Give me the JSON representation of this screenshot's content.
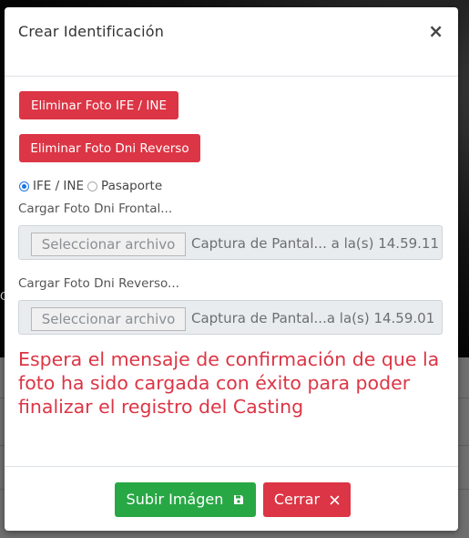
{
  "background": {
    "edge_char": "C"
  },
  "modal": {
    "title": "Crear Identificación",
    "close_symbol": "×",
    "delete_front_label": "Eliminar Foto IFE / INE",
    "delete_back_label": "Eliminar Foto Dni Reverso",
    "id_type": {
      "options": [
        {
          "label": "IFE / INE",
          "selected": true
        },
        {
          "label": "Pasaporte",
          "selected": false
        }
      ]
    },
    "front_upload": {
      "label": "Cargar Foto Dni Frontal...",
      "button_label": "Seleccionar archivo",
      "file_name": "Captura de Pantal... a la(s) 14.59.11"
    },
    "back_upload": {
      "label": "Cargar Foto Dni Reverso...",
      "button_label": "Seleccionar archivo",
      "file_name": "Captura de Pantal...a la(s) 14.59.01"
    },
    "warning_text": "Espera el mensaje de confirmación de que la foto ha sido cargada con éxito para poder finalizar el registro del Casting",
    "footer": {
      "upload_label": "Subir Imágen",
      "upload_icon": "save-icon",
      "close_label": "Cerrar",
      "close_icon": "close-icon"
    }
  },
  "colors": {
    "danger": "#dc3545",
    "success": "#28a745",
    "radio_accent": "#1a73e8"
  }
}
